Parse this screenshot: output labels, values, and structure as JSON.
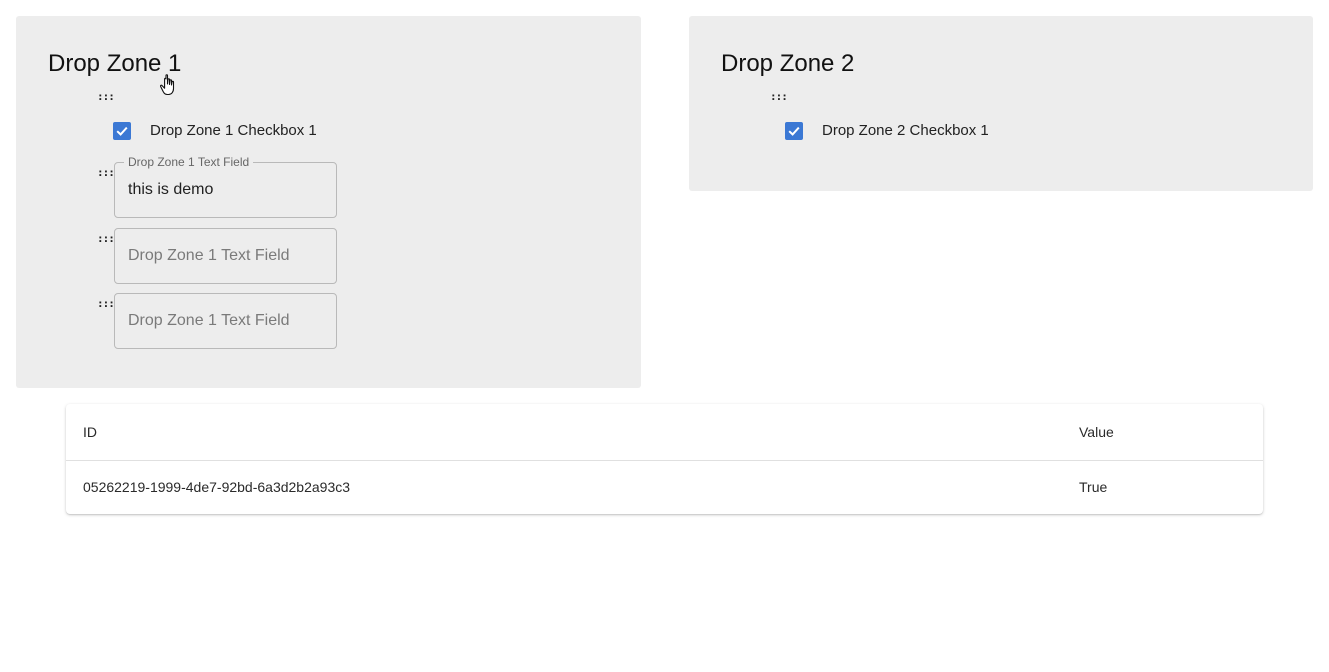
{
  "zone1": {
    "title": "Drop Zone 1",
    "checkbox": {
      "label": "Drop Zone 1 Checkbox 1",
      "checked": true
    },
    "text_fields": [
      {
        "label": "Drop Zone 1 Text Field",
        "value": "this is demo",
        "placeholder": ""
      },
      {
        "label": "",
        "value": "",
        "placeholder": "Drop Zone 1 Text Field"
      },
      {
        "label": "",
        "value": "",
        "placeholder": "Drop Zone 1 Text Field"
      }
    ]
  },
  "zone2": {
    "title": "Drop Zone 2",
    "checkbox": {
      "label": "Drop Zone 2 Checkbox 1",
      "checked": true
    }
  },
  "drag_handle": ":::",
  "table": {
    "headers": {
      "id": "ID",
      "value": "Value"
    },
    "rows": [
      {
        "id": "05262219-1999-4de7-92bd-6a3d2b2a93c3",
        "value": "True"
      }
    ]
  },
  "colors": {
    "zone_background": "#ededed",
    "checkbox_accent": "#3b78d4",
    "field_border": "#b9b9b9"
  },
  "icons": {
    "checkbox_checked": "check-icon",
    "drag_handle": "drag-handle-icon",
    "cursor": "hand-cursor-icon"
  }
}
